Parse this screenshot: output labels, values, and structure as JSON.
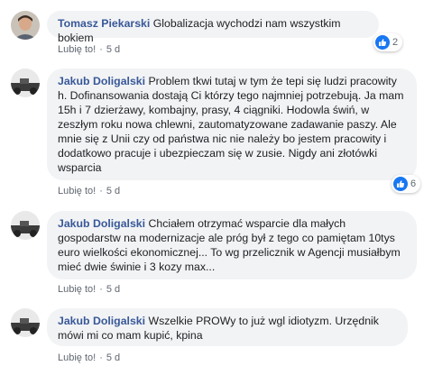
{
  "like_label": "Lubię to!",
  "colors": {
    "author": "#385898",
    "bubble": "#f2f3f5",
    "like_blue": "#1877f2",
    "meta": "#606770"
  },
  "comments": [
    {
      "author": "Tomasz Piekarski",
      "text": "Globalizacja wychodzi nam wszystkim bokiem",
      "time": "5 d",
      "reactions": "2"
    },
    {
      "author": "Jakub Doligalski",
      "text": "Problem tkwi tutaj w tym że tepi się ludzi pracowity h. Dofinansowania dostają Ci którzy tego najmniej potrzebują. Ja mam 15h i 7 dzierżawy, kombajny, prasy, 4 ciągniki. Hodowla świń, w zeszłym roku nowa chlewni, zautomatyzowane zadawanie paszy. Ale mnie się z Unii czy od państwa nic nie należy bo jestem pracowity i dodatkowo pracuje i ubezpieczam się w zusie. Nigdy ani złotówki wsparcia",
      "time": "5 d",
      "reactions": "6"
    },
    {
      "author": "Jakub Doligalski",
      "text": "Chciałem otrzymać wsparcie dla małych gospodarstw na modernizacje ale próg był z tego co pamiętam 10tys euro wielkości ekonomicznej... To wg przelicznik w Agencji musiałbym mieć dwie świnie i 3 kozy max...",
      "time": "5 d"
    },
    {
      "author": "Jakub Doligalski",
      "text": "Wszelkie PROWy to już wgl idiotyzm. Urzędnik mówi mi co mam kupić, kpina",
      "time": "5 d"
    }
  ]
}
